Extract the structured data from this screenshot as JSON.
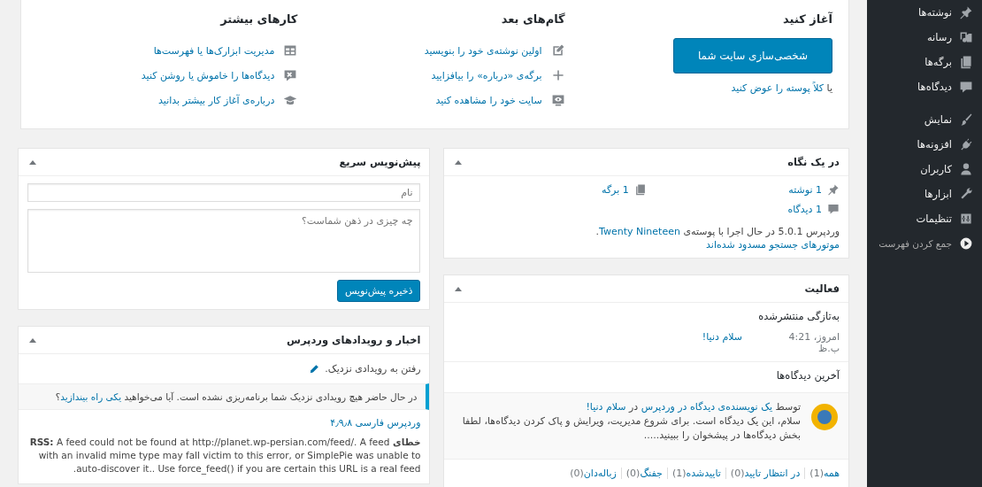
{
  "sidebar": {
    "groups": [
      {
        "items": [
          {
            "label": "نوشته‌ها",
            "kind": "menu"
          },
          {
            "label": "رسانه",
            "kind": "menu"
          },
          {
            "label": "برگه‌ها",
            "kind": "menu"
          },
          {
            "label": "دیدگاه‌ها",
            "kind": "menu"
          }
        ]
      },
      {
        "items": [
          {
            "label": "نمایش",
            "kind": "menu"
          },
          {
            "label": "افزونه‌ها",
            "kind": "menu"
          },
          {
            "label": "کاربران",
            "kind": "menu"
          },
          {
            "label": "ابزارها",
            "kind": "menu"
          },
          {
            "label": "تنظیمات",
            "kind": "menu"
          },
          {
            "label": "جمع کردن فهرست",
            "kind": "collapse"
          }
        ]
      }
    ]
  },
  "welcome": {
    "start": {
      "title": "آغاز کنید",
      "button": "شخصی‌سازی سایت شما",
      "note_prefix": "یا",
      "note_link": "کلاً پوسته را عوض کنید"
    },
    "next_steps": {
      "title": "گام‌های بعد",
      "links": [
        "اولین نوشته‌ی خود را بنویسید",
        "برگه‌ی «درباره» را بیافزایید",
        "سایت خود را مشاهده کنید"
      ]
    },
    "more_actions": {
      "title": "کارهای بیشتر",
      "links": [
        "مدیریت ابزارک‌ها یا فهرست‌ها",
        "دیدگاه‌ها را خاموش یا روشن کنید",
        "درباره‌ی آغاز کار بیشتر بدانید"
      ]
    }
  },
  "at_a_glance": {
    "title": "در یک نگاه",
    "stats": [
      "1 نوشته",
      "1 برگه",
      "1 دیدگاه"
    ],
    "version_before": "وردپرس 5.0.1 در حال اجرا با پوسته‌ی",
    "theme_link": "Twenty Nineteen",
    "version_after": ".",
    "search_engines": "موتورهای جستجو مسدود شده‌اند"
  },
  "activity": {
    "title": "فعالیت",
    "recently_published": {
      "heading": "به‌تازگی منتشرشده",
      "rows": [
        {
          "date": "امروز، 4:21 ب.ظ",
          "link": "سلام دنیا!"
        }
      ]
    },
    "recent_comments": {
      "heading": "آخرین دیدگاه‌ها",
      "comments": [
        {
          "by": "توسط",
          "author": "یک نویسنده‌ی دیدگاه در وردپرس",
          "in": "در",
          "post": "سلام دنیا!",
          "body": "سلام، این یک دیدگاه است. برای شروع مدیریت، ویرایش و پاک کردن دیدگاه‌ها، لطفا بخش دیدگاه‌ها در پیشخوان را ببینید....."
        }
      ]
    },
    "filters": [
      {
        "label": "همه",
        "count": "(1)"
      },
      {
        "label": "در انتظار تایید",
        "count": "(0)"
      },
      {
        "label": "تاییدشده",
        "count": "(1)"
      },
      {
        "label": "جفنگ",
        "count": "(0)"
      },
      {
        "label": "زباله‌دان",
        "count": "(0)"
      }
    ]
  },
  "quick_draft": {
    "title": "پیش‌نویس سریع",
    "title_placeholder": "نام",
    "content_placeholder": "چه چیزی در ذهن شماست؟",
    "button": "ذخیره پیش‌نویس"
  },
  "news": {
    "title": "اخبار و رویدادهای وردپرس",
    "events_intro": "رفتن به رویدادی نزدیک.",
    "notice_text": "در حال حاضر هیچ رویدادی نزدیک شما برنامه‌ریزی نشده است. آیا می‌خواهید",
    "notice_link": "یکی راه بیندازید",
    "notice_after": "؟",
    "feed_title": "وردپرس فارسی ۴٫۹٫۸",
    "error": "**خطای RSS:** A feed could not be found at http://planet.wp-persian.com/feed/. A feed with an invalid mime type may fall victim to this error, or SimplePie was unable to auto-discover it.. Use force_feed() if you are certain this URL is a real feed."
  }
}
